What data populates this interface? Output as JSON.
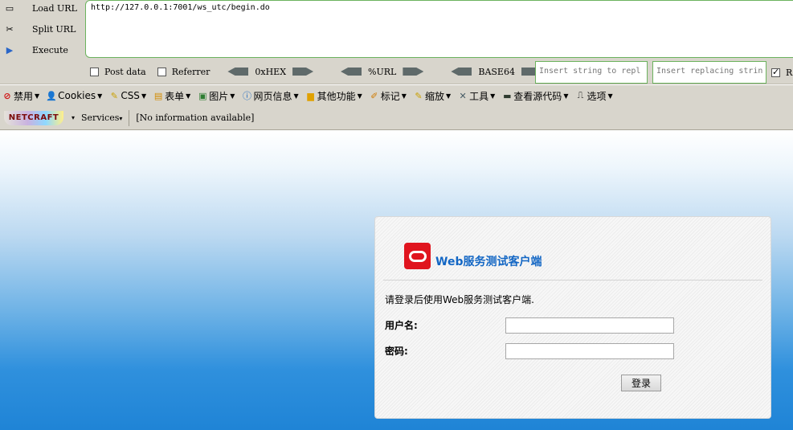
{
  "hackbar": {
    "load_url": "Load URL",
    "split_url": "Split URL",
    "execute": "Execute",
    "url_value": "http://127.0.0.1:7001/ws_utc/begin.do",
    "post_data": "Post data",
    "referrer": "Referrer",
    "oxhex": "0xHEX",
    "url_enc": "%URL",
    "base64": "BASE64",
    "replace_placeholder": "Insert string to repl",
    "replacing_placeholder": "Insert replacing strin",
    "replace_check_label": "R"
  },
  "webdev": {
    "items": [
      {
        "label": "禁用",
        "icon": "ban-icon"
      },
      {
        "label": "Cookies",
        "icon": "user-icon"
      },
      {
        "label": "CSS",
        "icon": "pencil-icon"
      },
      {
        "label": "表单",
        "icon": "form-icon"
      },
      {
        "label": "图片",
        "icon": "image-icon"
      },
      {
        "label": "网页信息",
        "icon": "info-icon"
      },
      {
        "label": "其他功能",
        "icon": "folder-icon"
      },
      {
        "label": "标记",
        "icon": "marker-icon"
      },
      {
        "label": "缩放",
        "icon": "resize-icon"
      },
      {
        "label": "工具",
        "icon": "tools-icon"
      },
      {
        "label": "查看源代码",
        "icon": "source-icon"
      },
      {
        "label": "选项",
        "icon": "options-icon"
      }
    ]
  },
  "netcraft": {
    "logo_text": "NETCRAFT",
    "services": "Services",
    "info": "[No information available]"
  },
  "login": {
    "title": "Web服务测试客户端",
    "instruction": "请登录后使用Web服务测试客户端.",
    "username_label": "用户名:",
    "password_label": "密码:",
    "submit": "登录"
  },
  "colors": {
    "brand_red": "#e0141e",
    "title_blue": "#1266c4",
    "page_blue": "#1f84d6"
  }
}
